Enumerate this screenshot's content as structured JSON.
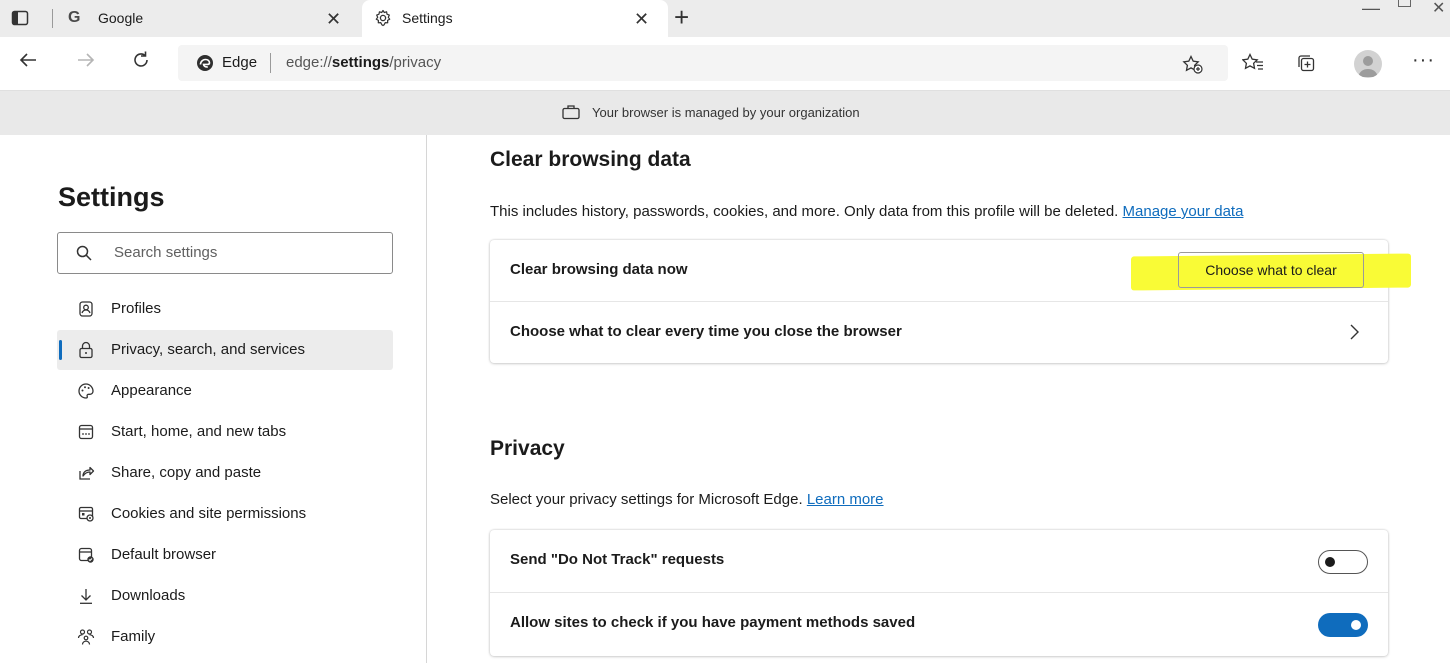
{
  "tabs": [
    {
      "title": "Google",
      "icon": "google-icon",
      "active": false
    },
    {
      "title": "Settings",
      "icon": "gear-icon",
      "active": true
    }
  ],
  "toolbar": {
    "site_label": "Edge",
    "url_prefix": "edge://",
    "url_bold": "settings",
    "url_suffix": "/privacy"
  },
  "banner": {
    "text": "Your browser is managed by your organization"
  },
  "sidebar": {
    "title": "Settings",
    "search_placeholder": "Search settings",
    "items": [
      {
        "label": "Profiles",
        "icon": "profiles-icon",
        "active": false
      },
      {
        "label": "Privacy, search, and services",
        "icon": "lock-icon",
        "active": true
      },
      {
        "label": "Appearance",
        "icon": "palette-icon",
        "active": false
      },
      {
        "label": "Start, home, and new tabs",
        "icon": "start-tabs-icon",
        "active": false
      },
      {
        "label": "Share, copy and paste",
        "icon": "share-icon",
        "active": false
      },
      {
        "label": "Cookies and site permissions",
        "icon": "cookies-icon",
        "active": false
      },
      {
        "label": "Default browser",
        "icon": "default-browser-icon",
        "active": false
      },
      {
        "label": "Downloads",
        "icon": "download-icon",
        "active": false
      },
      {
        "label": "Family",
        "icon": "family-icon",
        "active": false
      }
    ]
  },
  "clear_browsing": {
    "title": "Clear browsing data",
    "description": "This includes history, passwords, cookies, and more. Only data from this profile will be deleted.",
    "link": "Manage your data",
    "rows": [
      {
        "label": "Clear browsing data now",
        "button": "Choose what to clear"
      },
      {
        "label": "Choose what to clear every time you close the browser"
      }
    ]
  },
  "privacy": {
    "title": "Privacy",
    "description": "Select your privacy settings for Microsoft Edge.",
    "link": "Learn more",
    "rows": [
      {
        "label": "Send \"Do Not Track\" requests",
        "enabled": false
      },
      {
        "label": "Allow sites to check if you have payment methods saved",
        "enabled": true
      }
    ]
  },
  "colors": {
    "accent": "#0f6cbd",
    "highlight": "#f9fb36",
    "banner_bg": "#e9e9e9"
  }
}
